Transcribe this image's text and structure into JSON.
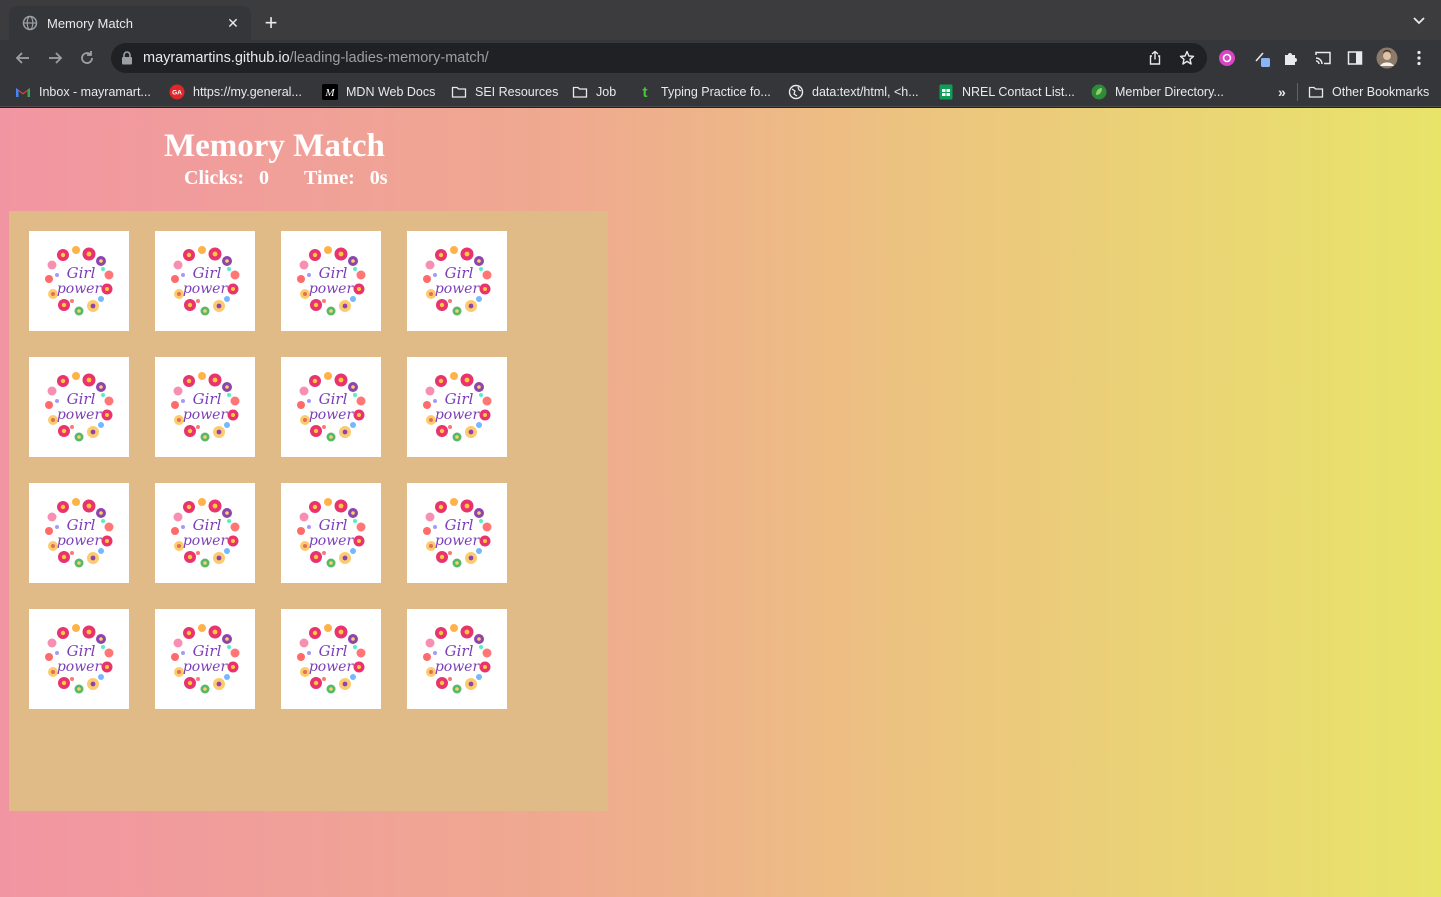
{
  "browser": {
    "tab": {
      "title": "Memory Match"
    },
    "address": {
      "host": "mayramartins.github.io",
      "path": "/leading-ladies-memory-match/"
    },
    "bookmarks": [
      {
        "label": "Inbox - mayramart...",
        "icon": "gmail-icon"
      },
      {
        "label": "https://my.general...",
        "icon": "ga-icon"
      },
      {
        "label": "MDN Web Docs",
        "icon": "mdn-icon"
      },
      {
        "label": "SEI Resources",
        "icon": "folder-icon"
      },
      {
        "label": "Job",
        "icon": "folder-icon"
      },
      {
        "label": "Typing Practice fo...",
        "icon": "typing-icon"
      },
      {
        "label": "data:text/html, <h...",
        "icon": "globe-icon"
      },
      {
        "label": "NREL Contact List...",
        "icon": "sheets-icon"
      },
      {
        "label": "Member Directory...",
        "icon": "leaf-icon"
      }
    ],
    "overflow": "»",
    "other_bookmarks": "Other Bookmarks"
  },
  "game": {
    "title": "Memory Match",
    "clicks_label": "Clicks:",
    "clicks_value": "0",
    "time_label": "Time:",
    "time_value": "0s",
    "card_face": "Girl Power",
    "card_count": 16
  },
  "colors": {
    "board": "#e0bb87",
    "gradient_start": "#f295a2",
    "gradient_end": "#e8e46a"
  }
}
